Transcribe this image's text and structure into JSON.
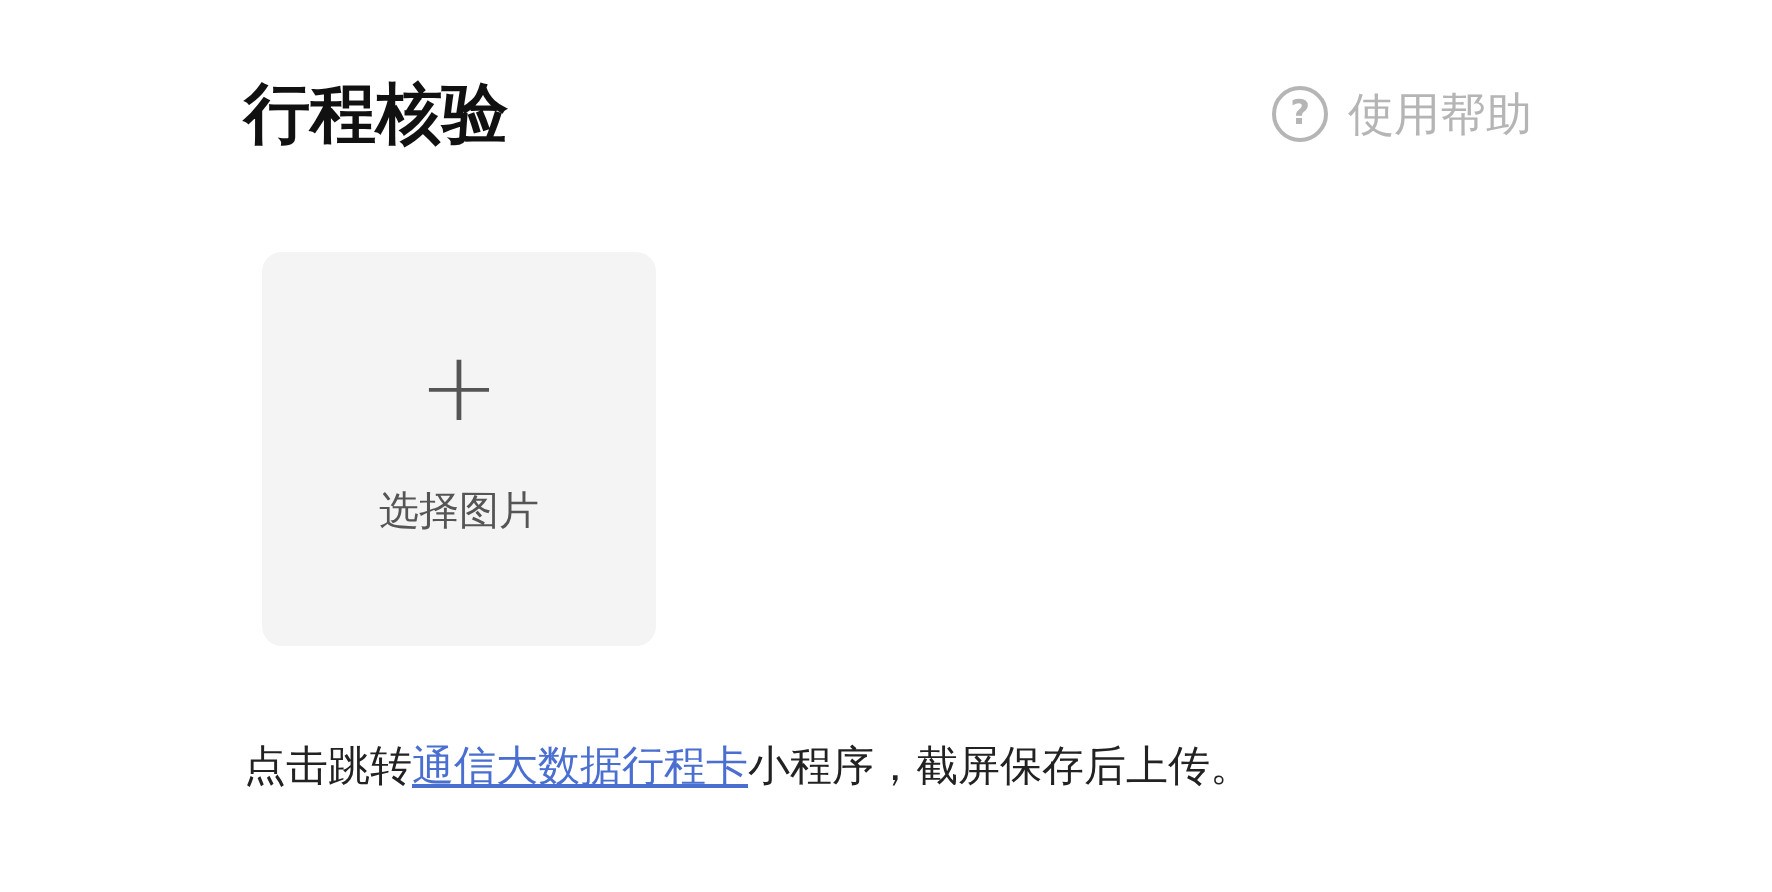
{
  "title": "行程核验",
  "help": {
    "icon": "?",
    "label": "使用帮助"
  },
  "upload": {
    "icon": "+",
    "label": "选择图片"
  },
  "instruction": {
    "before": "点击跳转",
    "link": "通信大数据行程卡",
    "after": "小程序，截屏保存后上传。"
  }
}
